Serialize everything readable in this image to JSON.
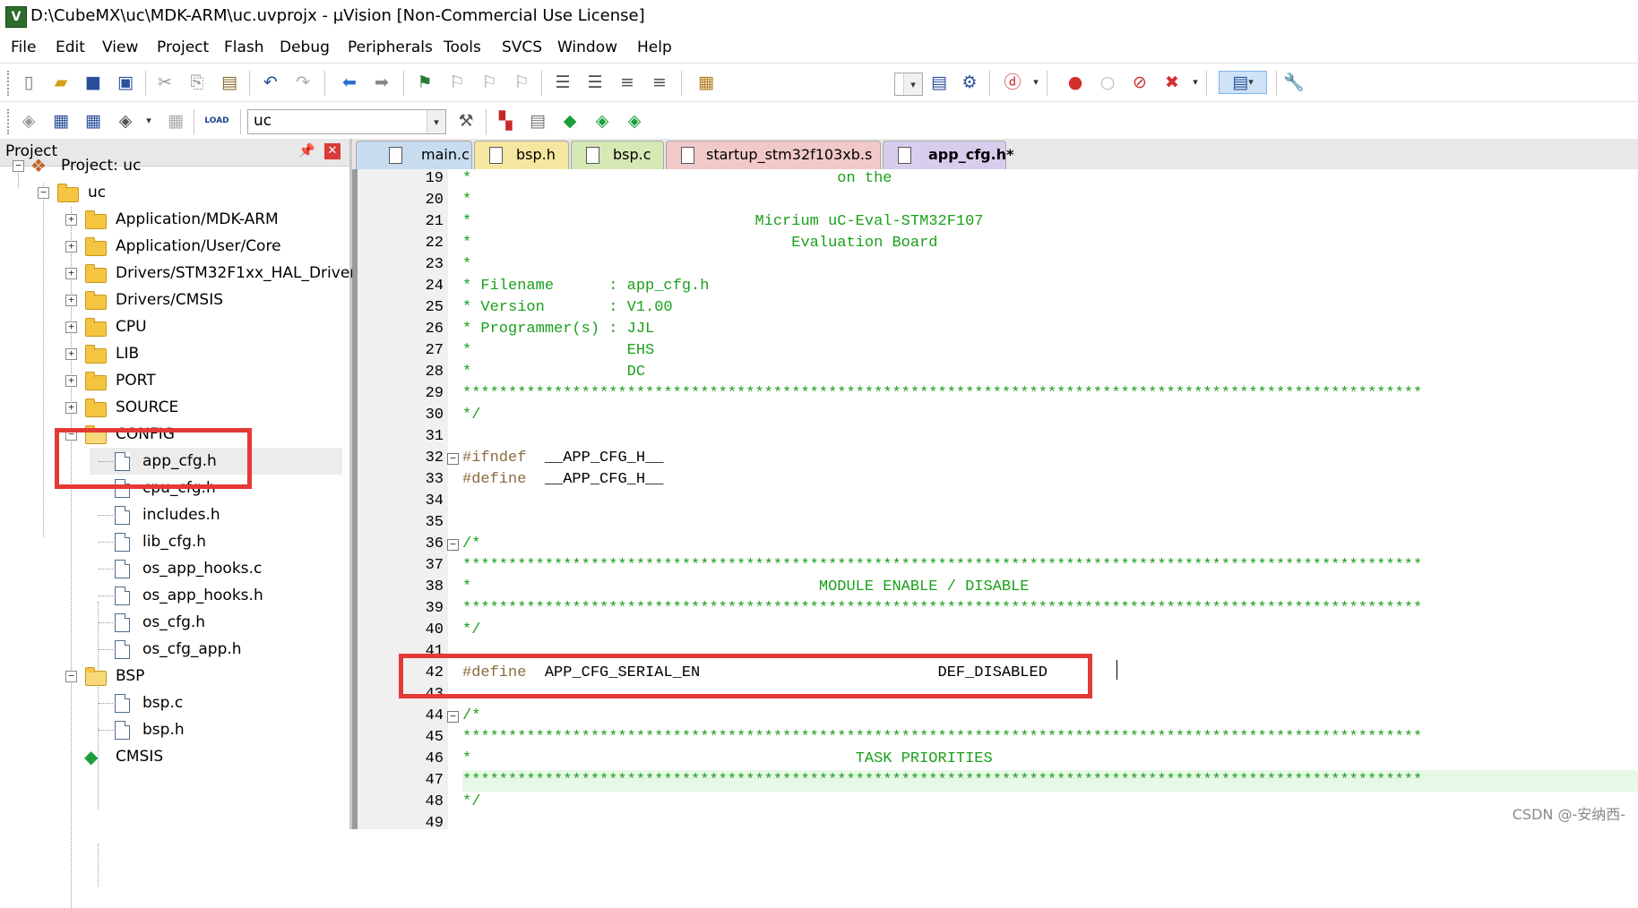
{
  "title": "D:\\CubeMX\\uc\\MDK-ARM\\uc.uvprojx - µVision  [Non-Commercial Use License]",
  "menu": [
    "File",
    "Edit",
    "View",
    "Project",
    "Flash",
    "Debug",
    "Peripherals",
    "Tools",
    "SVCS",
    "Window",
    "Help"
  ],
  "toolbar2": {
    "target_value": "uc"
  },
  "project": {
    "title": "Project",
    "tree": [
      {
        "label": "Project: uc"
      },
      {
        "label": "uc"
      },
      {
        "label": "Application/MDK-ARM"
      },
      {
        "label": "Application/User/Core"
      },
      {
        "label": "Drivers/STM32F1xx_HAL_Driver"
      },
      {
        "label": "Drivers/CMSIS"
      },
      {
        "label": "CPU"
      },
      {
        "label": "LIB"
      },
      {
        "label": "PORT"
      },
      {
        "label": "SOURCE"
      },
      {
        "label": "CONFIG"
      },
      {
        "label": "app_cfg.h"
      },
      {
        "label": "cpu_cfg.h"
      },
      {
        "label": "includes.h"
      },
      {
        "label": "lib_cfg.h"
      },
      {
        "label": "os_app_hooks.c"
      },
      {
        "label": "os_app_hooks.h"
      },
      {
        "label": "os_cfg.h"
      },
      {
        "label": "os_cfg_app.h"
      },
      {
        "label": "BSP"
      },
      {
        "label": "bsp.c"
      },
      {
        "label": "bsp.h"
      },
      {
        "label": "CMSIS"
      }
    ]
  },
  "tabs": [
    {
      "label": "main.c",
      "color": "#c8dcf0"
    },
    {
      "label": "bsp.h",
      "color": "#f6e7a0"
    },
    {
      "label": "bsp.c",
      "color": "#d6e8b4"
    },
    {
      "label": "startup_stm32f103xb.s",
      "color": "#f2c9c9"
    },
    {
      "label": "app_cfg.h*",
      "color": "#d9cdee",
      "active": true
    }
  ],
  "editor": {
    "lines": [
      {
        "n": "19",
        "text": "*                                        on the",
        "kind": "com"
      },
      {
        "n": "20",
        "text": "*",
        "kind": "com"
      },
      {
        "n": "21",
        "text": "*                               Micrium uC-Eval-STM32F107",
        "kind": "com"
      },
      {
        "n": "22",
        "text": "*                                   Evaluation Board",
        "kind": "com"
      },
      {
        "n": "23",
        "text": "*",
        "kind": "com"
      },
      {
        "n": "24",
        "text": "* Filename      : app_cfg.h",
        "kind": "com"
      },
      {
        "n": "25",
        "text": "* Version       : V1.00",
        "kind": "com"
      },
      {
        "n": "26",
        "text": "* Programmer(s) : JJL",
        "kind": "com"
      },
      {
        "n": "27",
        "text": "*                 EHS",
        "kind": "com"
      },
      {
        "n": "28",
        "text": "*                 DC",
        "kind": "com"
      },
      {
        "n": "29",
        "text": "*********************************************************************************************************",
        "kind": "com"
      },
      {
        "n": "30",
        "text": "*/",
        "kind": "com"
      },
      {
        "n": "31",
        "text": "",
        "kind": "txt"
      },
      {
        "n": "32",
        "pp": "#ifndef",
        "text": "  __APP_CFG_H__",
        "kind": "pp",
        "fold": true
      },
      {
        "n": "33",
        "pp": "#define",
        "text": "  __APP_CFG_H__",
        "kind": "pp"
      },
      {
        "n": "34",
        "text": "",
        "kind": "txt"
      },
      {
        "n": "35",
        "text": "",
        "kind": "txt"
      },
      {
        "n": "36",
        "text": "/*",
        "kind": "com",
        "fold": true
      },
      {
        "n": "37",
        "text": "*********************************************************************************************************",
        "kind": "com"
      },
      {
        "n": "38",
        "text": "*                                      MODULE ENABLE / DISABLE",
        "kind": "com"
      },
      {
        "n": "39",
        "text": "*********************************************************************************************************",
        "kind": "com"
      },
      {
        "n": "40",
        "text": "*/",
        "kind": "com"
      },
      {
        "n": "41",
        "text": "",
        "kind": "txt"
      },
      {
        "n": "42",
        "pp": "#define",
        "text": "  APP_CFG_SERIAL_EN                          DEF_DISABLED",
        "kind": "pp"
      },
      {
        "n": "43",
        "text": "",
        "kind": "txt"
      },
      {
        "n": "44",
        "text": "/*",
        "kind": "com",
        "fold": true
      },
      {
        "n": "45",
        "text": "*********************************************************************************************************",
        "kind": "com"
      },
      {
        "n": "46",
        "text": "*                                          TASK PRIORITIES",
        "kind": "com"
      },
      {
        "n": "47",
        "text": "*********************************************************************************************************",
        "kind": "com",
        "current": true
      },
      {
        "n": "48",
        "text": "*/",
        "kind": "com"
      },
      {
        "n": "49",
        "text": "",
        "kind": "txt"
      }
    ]
  },
  "watermark": "CSDN @-安纳西-"
}
